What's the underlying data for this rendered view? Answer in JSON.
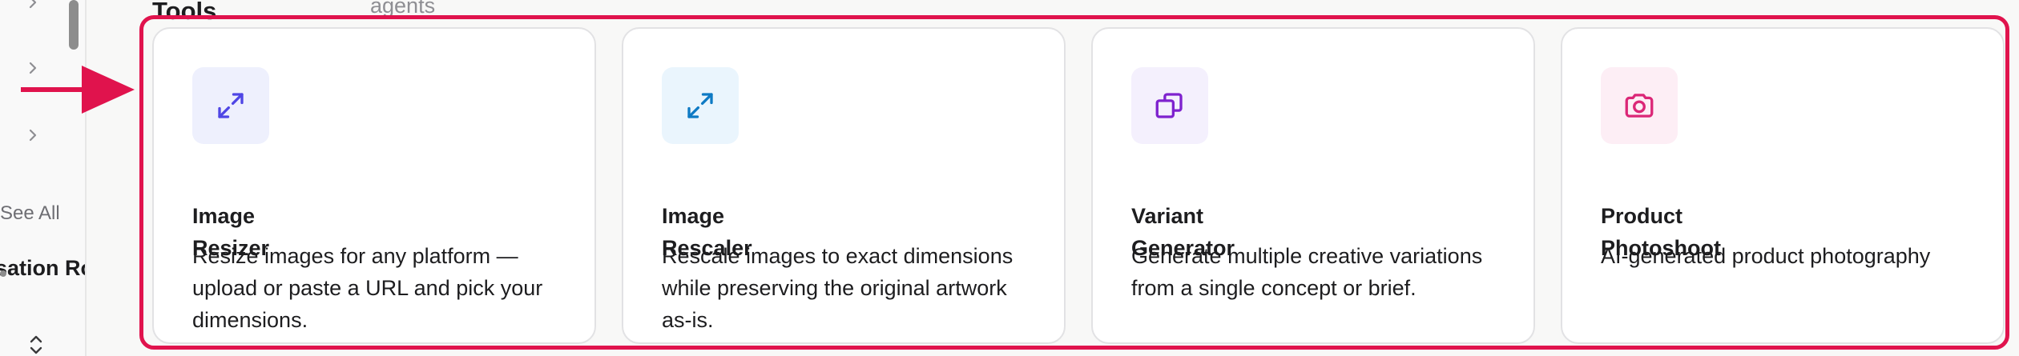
{
  "sidebar": {
    "see_all": "See All",
    "section_label": "sation Ro"
  },
  "main": {
    "header": "Tools",
    "agents_link": "agents"
  },
  "annotation": {
    "color": "#e0134d"
  },
  "tools": [
    {
      "title": "Image Resizer",
      "description": "Resize images for any platform — upload or paste a URL and pick your dimensions.",
      "icon": "expand-arrows-icon",
      "icon_color": "#4f46e5",
      "icon_bg": "#eef0fd"
    },
    {
      "title": "Image Rescaler",
      "description": "Rescale images to exact dimensions while preserving the original artwork as-is.",
      "icon": "expand-arrows-icon",
      "icon_color": "#0e7ac4",
      "icon_bg": "#eaf5fd"
    },
    {
      "title": "Variant Generator",
      "description": "Generate multiple creative variations from a single concept or brief.",
      "icon": "copy-icon",
      "icon_color": "#7e22ce",
      "icon_bg": "#f4f0fd"
    },
    {
      "title": "Product Photoshoot",
      "description": "AI-generated product photography",
      "icon": "camera-icon",
      "icon_color": "#db2777",
      "icon_bg": "#fdeef5"
    }
  ]
}
